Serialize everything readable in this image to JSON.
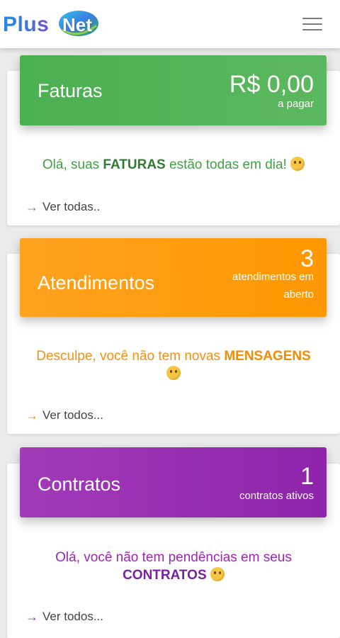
{
  "app": {
    "logo_part1": "Plus",
    "logo_part2": "Net"
  },
  "colors": {
    "faturas": "#4caf50",
    "atendimentos": "#ff9800",
    "contratos": "#9c27b0"
  },
  "cards": {
    "faturas": {
      "title": "Faturas",
      "value": "R$ 0,00",
      "value_label": "a pagar",
      "message_before": "Olá, suas",
      "message_bold": "FATURAS",
      "message_after": "estão todas em dia!",
      "emoji": "wink-emoji",
      "link": "Ver todas.."
    },
    "atendimentos": {
      "title": "Atendimentos",
      "value": "3",
      "value_label_line1": "atendimentos em",
      "value_label_line2": "aberto",
      "message_before": "Desculpe, você não tem novas",
      "message_bold": "MENSAGENS",
      "emoji": "confused-emoji",
      "link": "Ver todos..."
    },
    "contratos": {
      "title": "Contratos",
      "value": "1",
      "value_label": "contratos ativos",
      "message_before": "Olá, você não tem pendências em seus",
      "message_bold": "CONTRATOS",
      "emoji": "grin-emoji",
      "link": "Ver todos..."
    }
  }
}
